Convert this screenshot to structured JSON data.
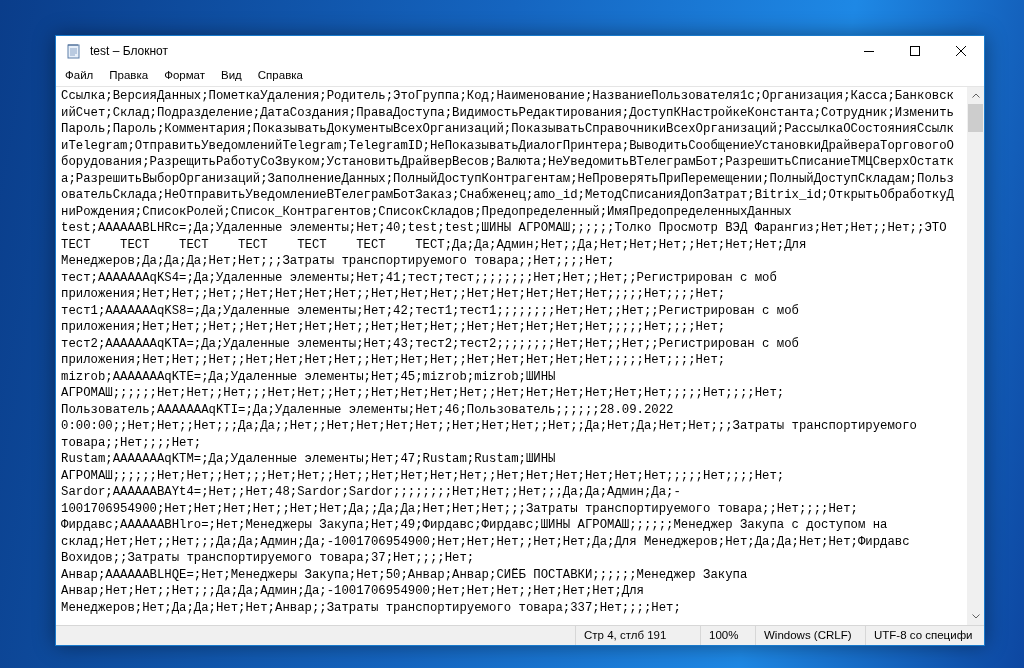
{
  "window": {
    "title": "test – Блокнот"
  },
  "menu": [
    "Файл",
    "Правка",
    "Формат",
    "Вид",
    "Справка"
  ],
  "lines": [
    "Ссылка;ВерсияДанных;ПометкаУдаления;Родитель;ЭтоГруппа;Код;Наименование;НазваниеПользователя1с;Организация;Касса;Банковск",
    "ийСчет;Склад;Подразделение;ДатаСоздания;ПраваДоступа;ВидимостьРедактирования;ДоступКНастройкеКонстанта;Сотрудник;Изменить",
    "Пароль;Пароль;Комментария;ПоказыватьДокументыВсехОрганизаций;ПоказыватьСправочникиВсехОрганизаций;РассылкаОСостоянияСсылк",
    "иTelegram;ОтправитьУведомленийTelegram;TelegramID;НеПоказыватьДиалогПринтера;ВыводитьСообщениеУстановкиДрайвераТорговогоО",
    "борудования;РазрещитьРаботуСоЗвуком;УстановитьДрайверВесов;Валюта;НеУведомитьВТелеграмБот;РазрешитьСписаниеТМЦСверхОстатк",
    "а;РазрешитьВыборОрганизаций;ЗаполнениеДанных;ПолныйДоступКонтрагентам;НеПроверятьПриПеремещении;ПолныйДоступСкладам;Польз",
    "овательСклада;НеОтправитьУведомлениеВТелеграмБотЗаказ;Снабженец;amo_id;МетодСписанияДопЗатрат;Bitrix_id;ОткрытьОбработкуД",
    "ниРождения;СписокРолей;Список_Контрагентов;СписокСкладов;Предопределенный;ИмяПредопределенныхДанных",
    "test;AAAAAABLHRc=;Да;Удаленные элементы;Нет;40;test;test;ШИНЫ АГРОМАШ;;;;;;Толко Просмотр ВЭД Фарангиз;Нет;Нет;;Нет;;ЭТО",
    "ТЕСТ\tТЕСТ\tТЕСТ\tТЕСТ\tТЕСТ\tТЕСТ\tТЕСТ;Да;Да;Админ;Нет;;Да;Нет;Нет;Нет;;Нет;Нет;Нет;Для",
    "Менеджеров;Да;Да;Да;Нет;Нет;;;Затраты транспортируемого товара;;Нет;;;;Нет;",
    "тест;AAAAAAAqKS4=;Да;Удаленные элементы;Нет;41;тест;тест;;;;;;;;Нет;Нет;;Нет;;Регистрирован с моб",
    "приложения;Нет;Нет;;Нет;;Нет;Нет;Нет;Нет;;Нет;Нет;Нет;;Нет;Нет;Нет;Нет;Нет;;;;;Нет;;;;Нет;",
    "тест1;AAAAAAAqKS8=;Да;Удаленные элементы;Нет;42;тест1;тест1;;;;;;;;Нет;Нет;;Нет;;Регистрирован с моб",
    "приложения;Нет;Нет;;Нет;;Нет;Нет;Нет;Нет;;Нет;Нет;Нет;;Нет;Нет;Нет;Нет;Нет;;;;;Нет;;;;Нет;",
    "тест2;AAAAAAAqKTA=;Да;Удаленные элементы;Нет;43;тест2;тест2;;;;;;;;Нет;Нет;;Нет;;Регистрирован с моб",
    "приложения;Нет;Нет;;Нет;;Нет;Нет;Нет;Нет;;Нет;Нет;Нет;;Нет;Нет;Нет;Нет;Нет;;;;;Нет;;;;Нет;",
    "mizrob;AAAAAAAqKTE=;Да;Удаленные элементы;Нет;45;mizrob;mizrob;ШИНЫ",
    "АГРОМАШ;;;;;;Нет;Нет;;Нет;;;Нет;Нет;;Нет;;Нет;Нет;Нет;Нет;;Нет;Нет;Нет;Нет;Нет;Нет;;;;;Нет;;;;Нет;",
    "Пользователь;AAAAAAAqKTI=;Да;Удаленные элементы;Нет;46;Пользователь;;;;;;28.09.2022",
    "0:00:00;;Нет;Нет;;Нет;;;Да;Да;;Нет;;Нет;Нет;Нет;Нет;;Нет;Нет;Нет;;Нет;;Да;Нет;Да;Нет;Нет;;;Затраты транспортируемого",
    "товара;;Нет;;;;Нет;",
    "Rustam;AAAAAAAqKTM=;Да;Удаленные элементы;Нет;47;Rustam;Rustam;ШИНЫ",
    "АГРОМАШ;;;;;;Нет;Нет;;Нет;;;Нет;Нет;;Нет;;Нет;Нет;Нет;Нет;;Нет;Нет;Нет;Нет;Нет;Нет;;;;;Нет;;;;Нет;",
    "Sardor;AAAAAABAYt4=;Нет;;Нет;48;Sardor;Sardor;;;;;;;;Нет;Нет;;Нет;;;Да;Да;Админ;Да;-",
    "1001706954900;Нет;Нет;Нет;Нет;;Нет;Нет;Да;;Да;Да;Нет;Нет;Нет;;;Затраты транспортируемого товара;;Нет;;;;Нет;",
    "Фирдавс;AAAAAABHlro=;Нет;Менеджеры Закупа;Нет;49;Фирдавс;Фирдавс;ШИНЫ АГРОМАШ;;;;;;Менеджер Закупа с доступом на",
    "склад;Нет;Нет;;Нет;;;Да;Да;Админ;Да;-1001706954900;Нет;Нет;Нет;;Нет;Нет;Да;Для Менеджеров;Нет;Да;Да;Нет;Нет;Фирдавс",
    "Вохидов;;Затраты транспортируемого товара;37;Нет;;;;Нет;",
    "Анвар;AAAAAABLHQE=;Нет;Менеджеры Закупа;Нет;50;Анвар;Анвар;СИЁБ ПОСТАВКИ;;;;;;Менеджер Закупа",
    "Анвар;Нет;Нет;;Нет;;;Да;Да;Админ;Да;-1001706954900;Нет;Нет;Нет;;Нет;Нет;Нет;Для",
    "Менеджеров;Нет;Да;Да;Нет;Нет;Анвар;;Затраты транспортируемого товара;337;Нет;;;;Нет;"
  ],
  "status_bar": [
    "Стр 4, стлб 191",
    "100%",
    "Windows (CRLF)",
    "UTF-8 со специфи"
  ]
}
